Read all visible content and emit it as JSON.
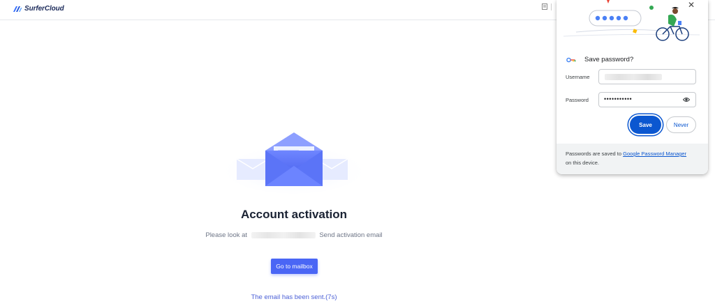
{
  "header": {
    "brand": "SurferCloud"
  },
  "main": {
    "title": "Account activation",
    "desc_prefix": "Please look at",
    "desc_suffix": "Send activation email",
    "mailbox_button": "Go to mailbox",
    "sent_status": "The email has been sent.(7s)"
  },
  "password_popup": {
    "title": "Save password?",
    "username_label": "Username",
    "password_label": "Password",
    "password_value": "•••••••••••",
    "save_label": "Save",
    "never_label": "Never",
    "footer_prefix": "Passwords are saved to",
    "footer_link": "Google Password Manager",
    "footer_suffix": "on this device."
  },
  "colors": {
    "primary_button": "#4a66f5",
    "save_button": "#0b57d0",
    "link": "#0b57d0"
  },
  "icons": [
    "surfercloud-logo-icon",
    "document-icon",
    "close-icon",
    "key-icon",
    "eye-icon",
    "envelope-icon"
  ]
}
